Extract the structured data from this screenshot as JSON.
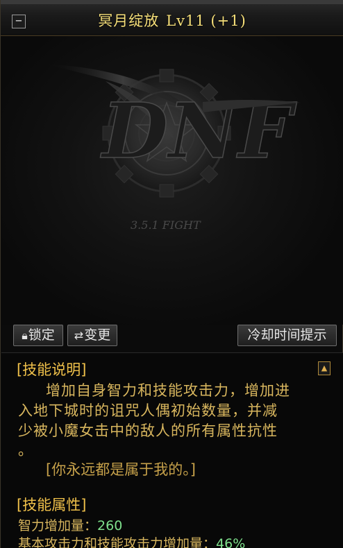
{
  "window": {
    "skill_name": "冥月绽放",
    "level": "Lv11 (+1)",
    "collapse_symbol": "−"
  },
  "art": {
    "logo_text": "DNF",
    "version_text": "3.5.1 FIGHT",
    "logo_icon": "dnf-logo-gear-icon"
  },
  "buttons": {
    "lock_label": "锁定",
    "lock_icon": "lock-icon",
    "change_label": "变更",
    "change_icon": "swap-icon",
    "cooldown_label": "冷却时间提示"
  },
  "description": {
    "section_title": "[技能说明]",
    "lines": [
      "增加自身智力和技能攻击力，增加进",
      "入地下城时的诅咒人偶初始数量，并减",
      "少被小魔女击中的敌人的所有属性抗性",
      "。"
    ],
    "quote": "[你永远都是属于我的。]",
    "scroll_icon": "scroll-up-icon"
  },
  "attributes": {
    "section_title": "[技能属性]",
    "items": [
      {
        "label": "智力增加量：",
        "value": "260"
      },
      {
        "label": "基本攻击力和技能攻击力增加量：",
        "value": "46%"
      }
    ]
  },
  "colors": {
    "title": "#f7e07a",
    "section": "#f0c14a",
    "text": "#d8b65e",
    "value": "#7ee08c"
  }
}
